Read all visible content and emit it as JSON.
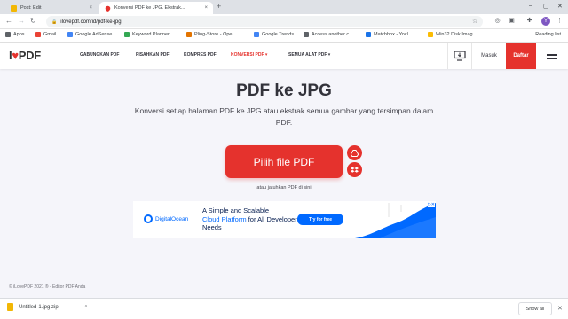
{
  "browser": {
    "tabs": [
      {
        "title": "Post: Edit",
        "active": false
      },
      {
        "title": "Konversi PDF ke JPG. Ekstrak...",
        "active": true
      }
    ],
    "new_tab": "+",
    "close_tab": "×",
    "url": "ilovepdf.com/id/pdf-ke-jpg",
    "bookmarks": [
      {
        "label": "Apps",
        "color": "#5f6368"
      },
      {
        "label": "Gmail",
        "color": "#ea4335"
      },
      {
        "label": "Google AdSense",
        "color": "#4285f4"
      },
      {
        "label": "Keyword Planner...",
        "color": "#34a853"
      },
      {
        "label": "Pling-Store - Ope...",
        "color": "#e37400"
      },
      {
        "label": "Google Trends",
        "color": "#4285f4"
      },
      {
        "label": "Access another c...",
        "color": "#5f6368"
      },
      {
        "label": "Matchbox - Yocl...",
        "color": "#1a73e8"
      },
      {
        "label": "Win32 Disk Imag...",
        "color": "#fbbc04"
      }
    ],
    "reading_list": "Reading list",
    "profile_initial": "Y"
  },
  "site": {
    "logo_i": "I",
    "logo_heart": "♥",
    "logo_pdf": "PDF",
    "nav": [
      {
        "label": "GABUNGKAN PDF",
        "active": false
      },
      {
        "label": "PISAHKAN PDF",
        "active": false
      },
      {
        "label": "KOMPRES PDF",
        "active": false
      },
      {
        "label": "KONVERSI PDF ▾",
        "active": true
      },
      {
        "label": "SEMUA ALAT PDF ▾",
        "active": false
      }
    ],
    "login": "Masuk",
    "signup": "Daftar"
  },
  "main": {
    "title": "PDF ke JPG",
    "subtitle": "Konversi setiap halaman PDF ke JPG atau ekstrak semua gambar yang tersimpan dalam PDF.",
    "pick_button": "Pilih file PDF",
    "drop_hint": "atau jatuhkan PDF di sini"
  },
  "ad": {
    "brand": "DigitalOcean",
    "line1": "A Simple and Scalable",
    "line2": "Cloud Platform",
    "line3": "for All Developer Needs",
    "cta": "Try for free"
  },
  "footer": "© iLovePDF 2021 ® - Editor PDF Anda",
  "downloads": {
    "file": "Untitled-1.jpg.zip",
    "show_all": "Show all"
  },
  "colors": {
    "brand_red": "#e5322d",
    "do_blue": "#0069ff"
  }
}
